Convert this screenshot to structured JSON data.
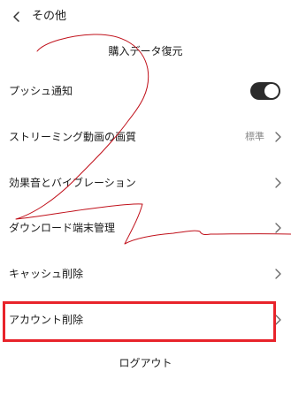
{
  "header": {
    "title": "その他",
    "back_icon": "chevron-left-icon"
  },
  "restore_label": "購入データ復元",
  "settings": [
    {
      "key": "push",
      "label": "プッシュ通知",
      "control": "toggle",
      "toggle_on": true
    },
    {
      "key": "quality",
      "label": "ストリーミング動画の画質",
      "value": "標準",
      "control": "chevron"
    },
    {
      "key": "sound",
      "label": "効果音とバイブレーション",
      "control": "chevron"
    },
    {
      "key": "devices",
      "label": "ダウンロード端末管理",
      "control": "chevron"
    },
    {
      "key": "cache",
      "label": "キャッシュ削除",
      "control": "chevron"
    },
    {
      "key": "account",
      "label": "アカウント削除",
      "control": "chevron"
    }
  ],
  "logout_label": "ログアウト",
  "colors": {
    "highlight": "#e8232a",
    "annotation": "#c0101a",
    "toggle_on": "#2b2b2b",
    "secondary_text": "#888888"
  }
}
